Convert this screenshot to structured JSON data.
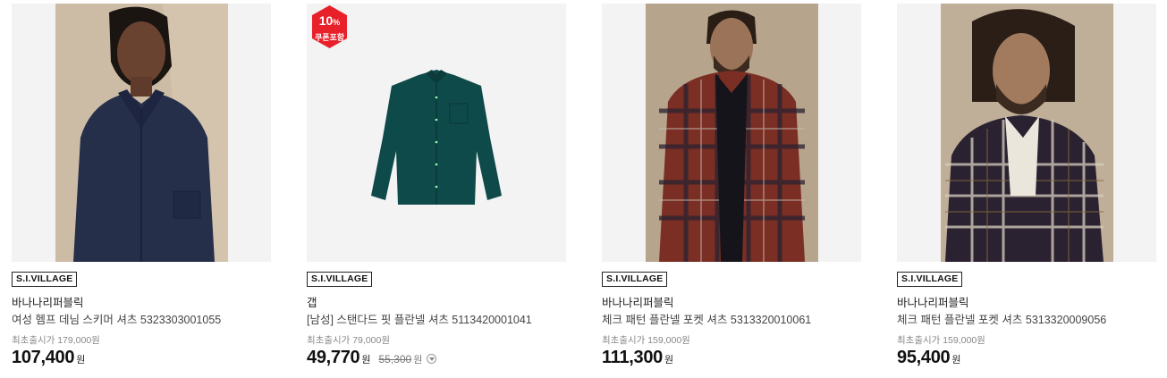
{
  "products": [
    {
      "brand_tag": "S.I.VILLAGE",
      "brand": "바나나리퍼블릭",
      "name": "여성 헴프 데님 스키머 셔츠 5323303001055",
      "original_label": "최초출시가 179,000원",
      "price": "107,400",
      "currency": "원"
    },
    {
      "badge_percent": "10",
      "badge_percent_sign": "%",
      "badge_label": "쿠폰포함",
      "brand_tag": "S.I.VILLAGE",
      "brand": "갭",
      "name": "[남성] 스탠다드 핏 플란넬 셔츠 5113420001041",
      "original_label": "최초출시가 79,000원",
      "price": "49,770",
      "currency": "원",
      "strike_price": "55,300",
      "strike_currency": "원"
    },
    {
      "brand_tag": "S.I.VILLAGE",
      "brand": "바나나리퍼블릭",
      "name": "체크 패턴 플란넬 포켓 셔츠 5313320010061",
      "original_label": "최초출시가 159,000원",
      "price": "111,300",
      "currency": "원"
    },
    {
      "brand_tag": "S.I.VILLAGE",
      "brand": "바나나리퍼블릭",
      "name": "체크 패턴 플란넬 포켓 셔츠 5313320009056",
      "original_label": "최초출시가 159,000원",
      "price": "95,400",
      "currency": "원"
    }
  ],
  "colors": {
    "badge_red": "#e8202a",
    "shirt_teal": "#0f4a4a",
    "denim": "#252f4a",
    "plaid_red": "#7a2e24",
    "plaid_dark": "#2a2230"
  }
}
